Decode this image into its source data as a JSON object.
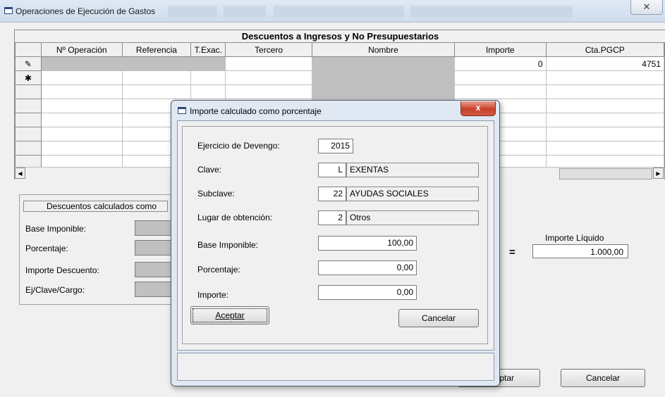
{
  "window": {
    "title": "Operaciones de Ejecución de Gastos",
    "close_label": "✕"
  },
  "grid": {
    "caption": "Descuentos a Ingresos y No Presupuestarios",
    "columns": [
      "Nº Operación",
      "Referencia",
      "T.Exac.",
      "Tercero",
      "Nombre",
      "Importe",
      "Cta.PGCP"
    ],
    "row1": {
      "importe": "0",
      "cta": "4751"
    },
    "row_markers": [
      "✎",
      "✱"
    ]
  },
  "panel": {
    "title": "Descuentos calculados como",
    "labels": {
      "base": "Base Imponible:",
      "porcentaje": "Porcentaje:",
      "importe": "Importe Descuento:",
      "ej": "Ej/Clave/Cargo:"
    },
    "importe_liquido_label": "Importe Líquido",
    "equals": "=",
    "importe_liquido_value": "1.000,00",
    "aceptar_partial": "ptar",
    "cancelar_label": "Cancelar"
  },
  "dialog": {
    "title": "Importe calculado como porcentaje",
    "close_label": "x",
    "labels": {
      "ejercicio": "Ejercicio de Devengo:",
      "clave": "Clave:",
      "subclave": "Subclave:",
      "lugar": "Lugar de obtención:",
      "base": "Base Imponible:",
      "porcentaje": "Porcentaje:",
      "importe": "Importe:"
    },
    "values": {
      "ejercicio": "2015",
      "clave": "L",
      "clave_desc": "EXENTAS",
      "subclave": "22",
      "subclave_desc": "AYUDAS SOCIALES",
      "lugar": "2",
      "lugar_desc": "Otros",
      "base": "100,00",
      "porcentaje": "0,00",
      "importe": "0,00"
    },
    "aceptar_label": "Aceptar",
    "cancelar_label": "Cancelar"
  },
  "colors": {
    "accent_close": "#c7412a",
    "grid_gray": "#c0c0c0"
  }
}
